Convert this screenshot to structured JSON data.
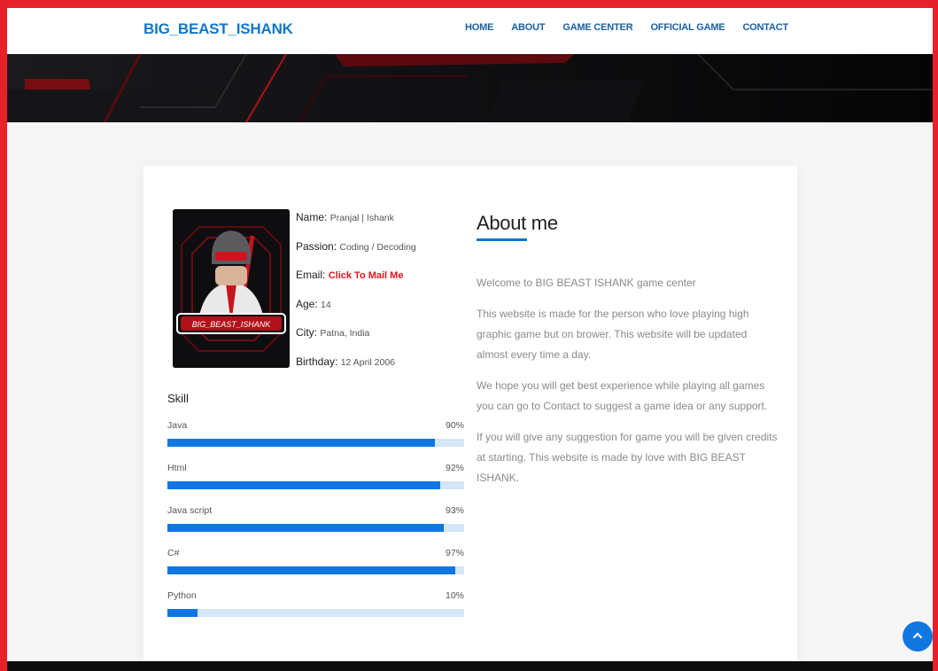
{
  "header": {
    "logo": "BIG_BEAST_ISHANK",
    "nav": [
      "HOME",
      "ABOUT",
      "GAME CENTER",
      "OFFICIAL GAME",
      "CONTACT"
    ]
  },
  "profile": {
    "rows": [
      {
        "key": "Name:",
        "value": "Pranjal | Ishank"
      },
      {
        "key": "Passion:",
        "value": "Coding / Decoding"
      },
      {
        "key": "Email:",
        "value": "Click To Mail Me"
      },
      {
        "key": "Age:",
        "value": "14"
      },
      {
        "key": "City:",
        "value": "Patna, India"
      },
      {
        "key": "Birthday:",
        "value": "12 April 2006"
      }
    ],
    "avatar_text": "BIG_BEAST_ISHANK"
  },
  "skills": {
    "title": "Skill",
    "items": [
      {
        "name": "Java",
        "percent": "90%",
        "level": 90
      },
      {
        "name": "Html",
        "percent": "92%",
        "level": 92
      },
      {
        "name": "Java script",
        "percent": "93%",
        "level": 93
      },
      {
        "name": "C#",
        "percent": "97%",
        "level": 97
      },
      {
        "name": "Python",
        "percent": "10%",
        "level": 10
      }
    ]
  },
  "about": {
    "title": "About me",
    "paragraphs": [
      "Welcome to BIG BEAST ISHANK game center",
      "This website is made for the person who love playing high graphic game but on brower. This website will be updated almost every time a day.",
      "We hope you will get best experience while playing all games you can go to Contact to suggest a game idea or any support.",
      "If you will give any suggestion for game you will be given credits at starting. This website is made by love with BIG BEAST ISHANK."
    ]
  },
  "colors": {
    "accent": "#1077c9",
    "bar": "#1077e0",
    "track": "#d4e6f8",
    "frame": "#e8202a",
    "mail": "#e0141b"
  },
  "icons": {
    "scroll_top": "chevron-up-icon"
  }
}
